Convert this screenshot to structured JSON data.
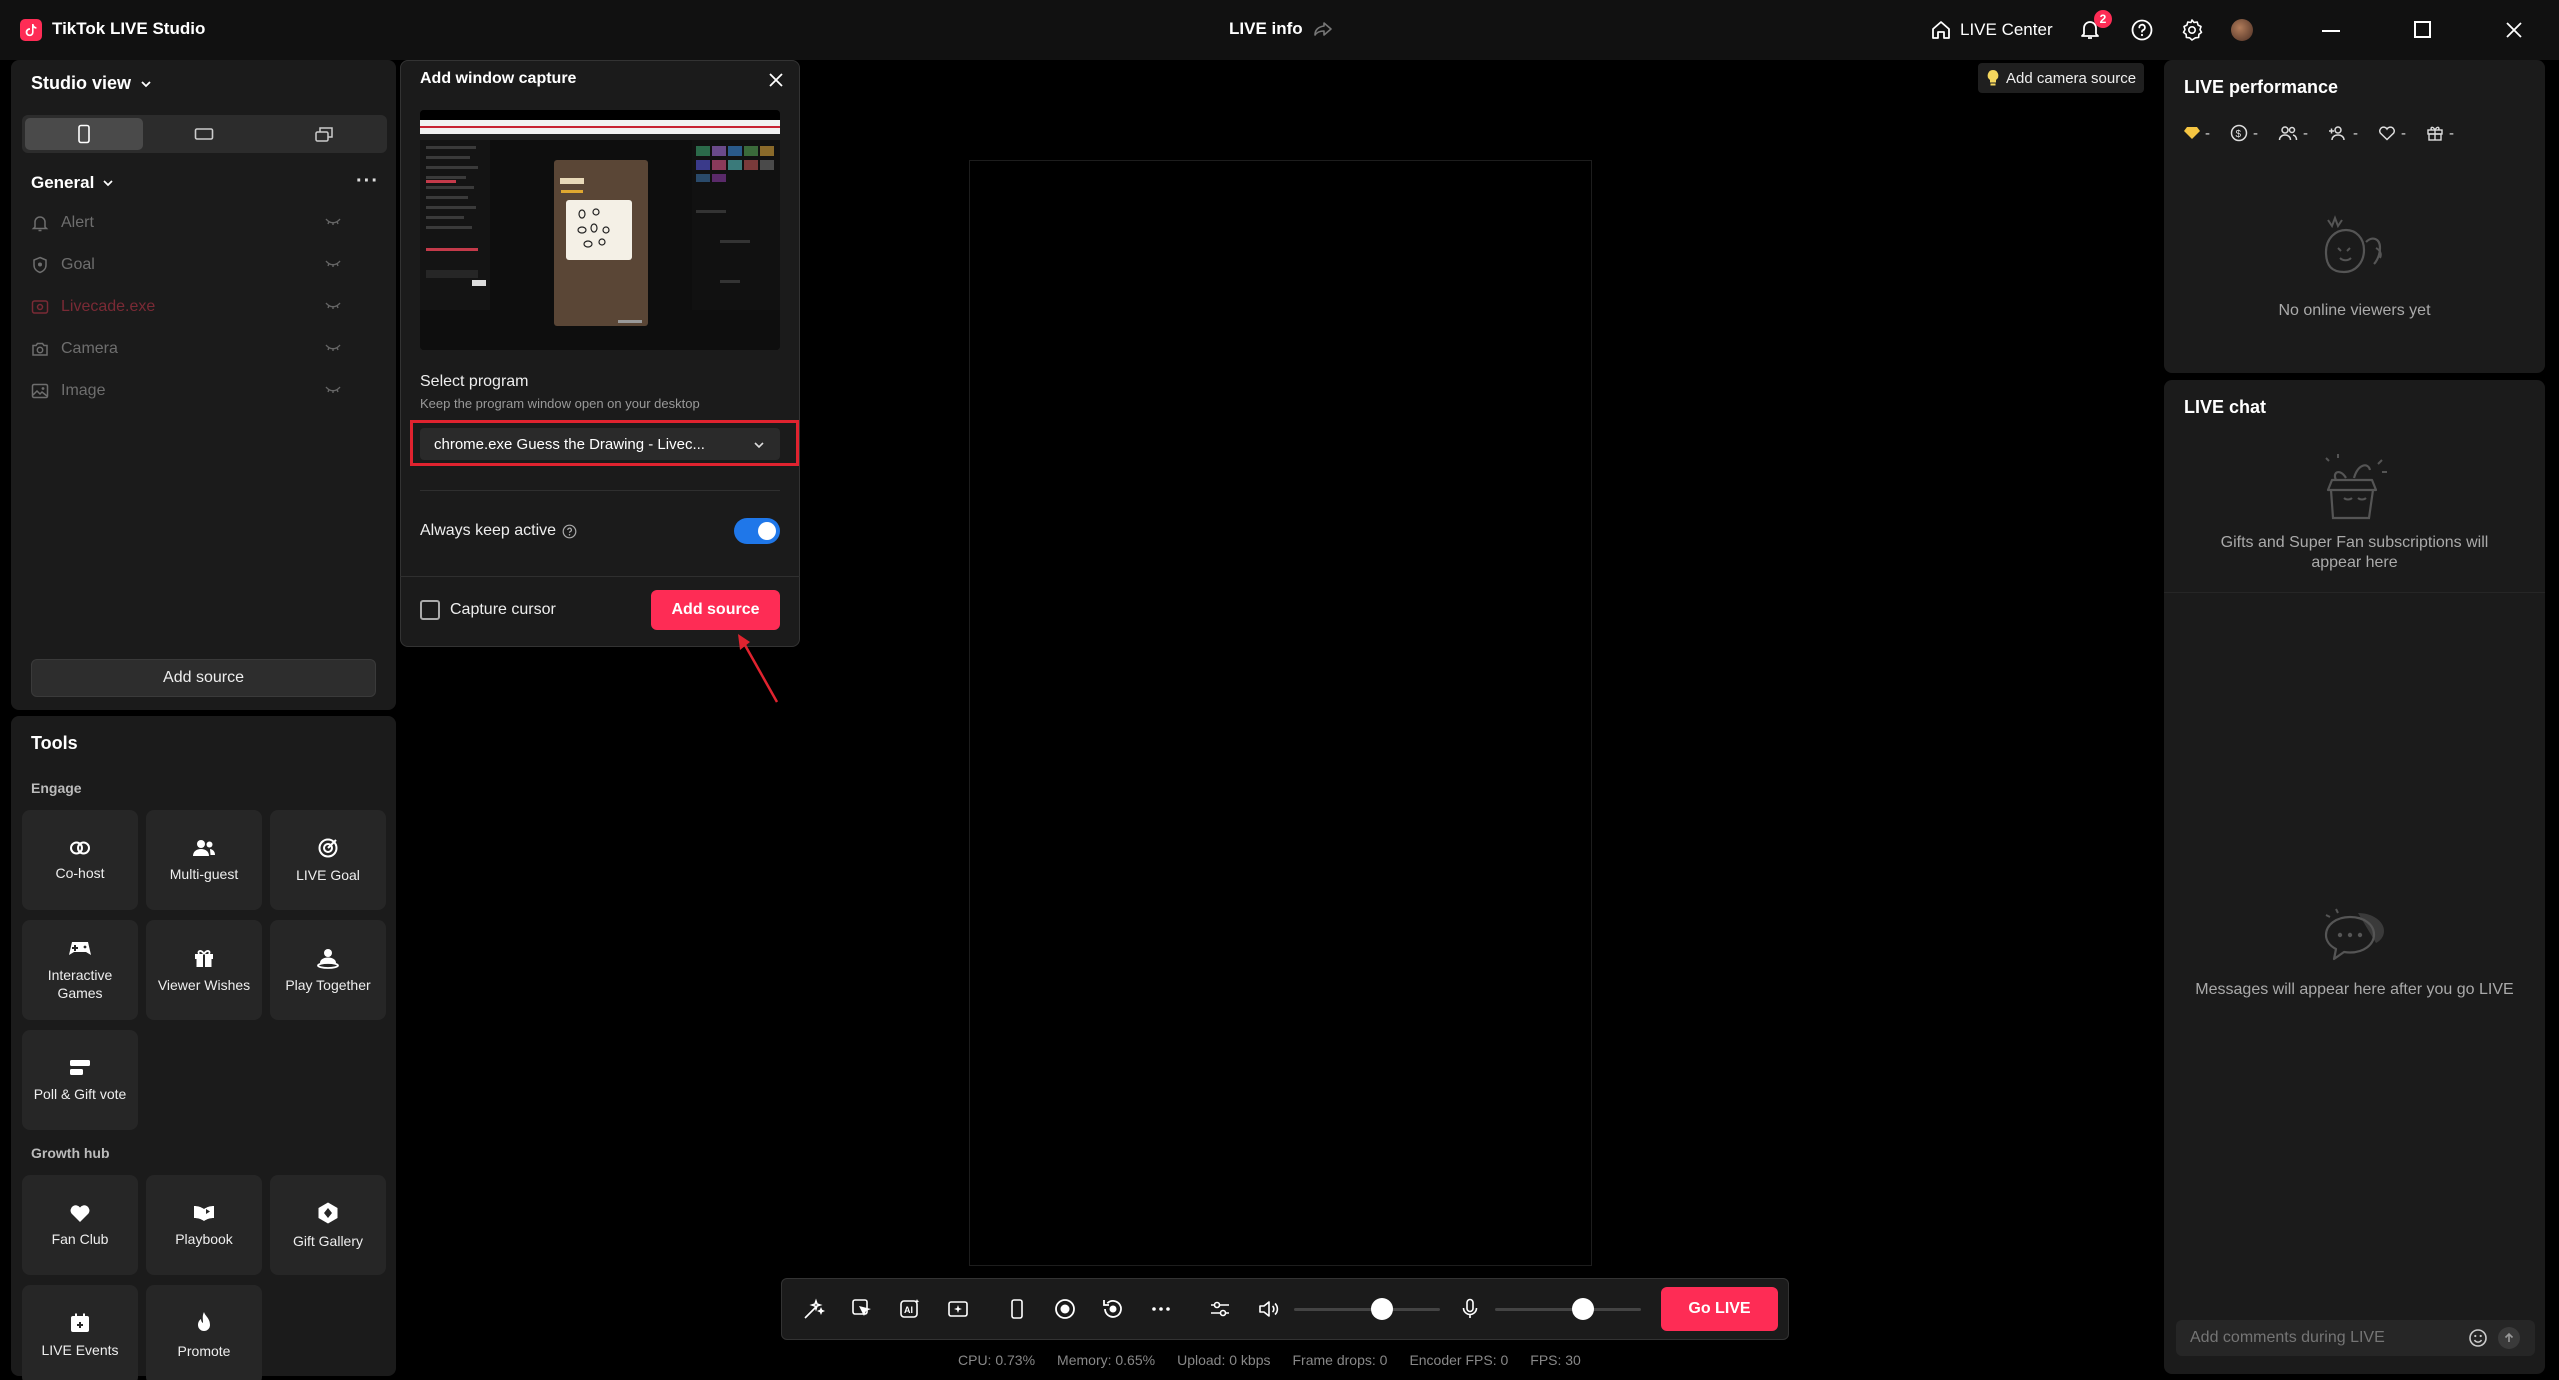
{
  "titlebar": {
    "app_title": "TikTok LIVE Studio",
    "center_title": "LIVE info",
    "live_center": "LIVE Center",
    "notification_count": "2"
  },
  "left": {
    "studio_view": "Studio view",
    "general": "General",
    "sources": [
      {
        "label": "Alert",
        "icon": "bell-icon"
      },
      {
        "label": "Goal",
        "icon": "shield-icon"
      },
      {
        "label": "Livecade.exe",
        "icon": "window-icon"
      },
      {
        "label": "Camera",
        "icon": "camera-icon"
      },
      {
        "label": "Image",
        "icon": "image-icon"
      }
    ],
    "add_source": "Add source"
  },
  "tools": {
    "title": "Tools",
    "engage_title": "Engage",
    "engage": [
      {
        "label": "Co-host"
      },
      {
        "label": "Multi-guest"
      },
      {
        "label": "LIVE Goal"
      },
      {
        "label": "Interactive Games"
      },
      {
        "label": "Viewer Wishes"
      },
      {
        "label": "Play Together"
      },
      {
        "label": "Poll & Gift vote"
      }
    ],
    "growth_title": "Growth hub",
    "growth": [
      {
        "label": "Fan Club"
      },
      {
        "label": "Playbook"
      },
      {
        "label": "Gift Gallery"
      },
      {
        "label": "LIVE Events"
      },
      {
        "label": "Promote"
      }
    ]
  },
  "dialog": {
    "title": "Add window capture",
    "select_label": "Select program",
    "select_hint": "Keep the program window open on your desktop",
    "program_value": "chrome.exe Guess the Drawing - Livec...",
    "always_active": "Always keep active",
    "always_active_on": true,
    "capture_cursor": "Capture cursor",
    "capture_cursor_checked": false,
    "add_source": "Add source"
  },
  "stage": {
    "camera_hint": "Add camera source"
  },
  "controls": {
    "speaker_volume": 0.6,
    "mic_volume": 0.6,
    "go_live": "Go LIVE"
  },
  "stats": {
    "cpu": "CPU:  0.73%",
    "memory": "Memory:  0.65%",
    "upload": "Upload:  0 kbps",
    "frame_drops": "Frame drops:  0",
    "encoder_fps": "Encoder FPS:  0",
    "fps": "FPS:  30"
  },
  "performance": {
    "title": "LIVE performance",
    "metrics": [
      {
        "icon": "diamond-icon",
        "value": "-"
      },
      {
        "icon": "coin-icon",
        "value": "-"
      },
      {
        "icon": "viewers-icon",
        "value": "-"
      },
      {
        "icon": "new-follower-icon",
        "value": "-"
      },
      {
        "icon": "heart-icon",
        "value": "-"
      },
      {
        "icon": "gift-icon",
        "value": "-"
      }
    ],
    "empty": "No online viewers yet"
  },
  "chat": {
    "title": "LIVE chat",
    "gifts_empty": "Gifts and Super Fan subscriptions will appear here",
    "messages_empty": "Messages will appear here after you go LIVE",
    "comment_placeholder": "Add comments during LIVE"
  },
  "colors": {
    "accent": "#fe2c55",
    "toggle_on": "#1f77e9",
    "highlight_frame": "#e0232f"
  }
}
